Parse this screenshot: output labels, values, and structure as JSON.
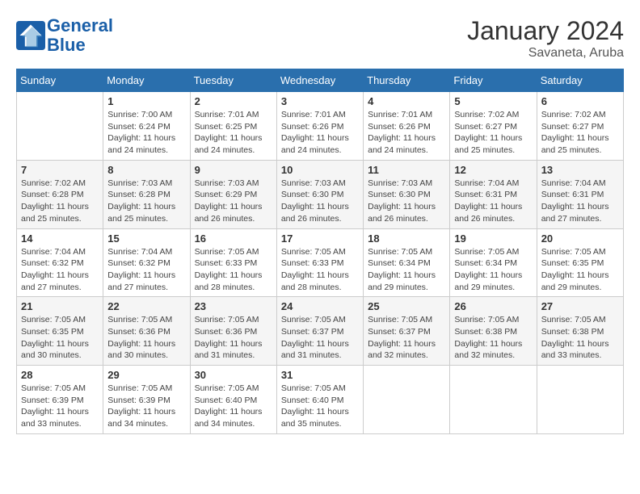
{
  "header": {
    "logo_line1": "General",
    "logo_line2": "Blue",
    "title": "January 2024",
    "subtitle": "Savaneta, Aruba"
  },
  "days_of_week": [
    "Sunday",
    "Monday",
    "Tuesday",
    "Wednesday",
    "Thursday",
    "Friday",
    "Saturday"
  ],
  "weeks": [
    [
      {
        "day": "",
        "info": ""
      },
      {
        "day": "1",
        "info": "Sunrise: 7:00 AM\nSunset: 6:24 PM\nDaylight: 11 hours\nand 24 minutes."
      },
      {
        "day": "2",
        "info": "Sunrise: 7:01 AM\nSunset: 6:25 PM\nDaylight: 11 hours\nand 24 minutes."
      },
      {
        "day": "3",
        "info": "Sunrise: 7:01 AM\nSunset: 6:26 PM\nDaylight: 11 hours\nand 24 minutes."
      },
      {
        "day": "4",
        "info": "Sunrise: 7:01 AM\nSunset: 6:26 PM\nDaylight: 11 hours\nand 24 minutes."
      },
      {
        "day": "5",
        "info": "Sunrise: 7:02 AM\nSunset: 6:27 PM\nDaylight: 11 hours\nand 25 minutes."
      },
      {
        "day": "6",
        "info": "Sunrise: 7:02 AM\nSunset: 6:27 PM\nDaylight: 11 hours\nand 25 minutes."
      }
    ],
    [
      {
        "day": "7",
        "info": "Sunrise: 7:02 AM\nSunset: 6:28 PM\nDaylight: 11 hours\nand 25 minutes."
      },
      {
        "day": "8",
        "info": "Sunrise: 7:03 AM\nSunset: 6:28 PM\nDaylight: 11 hours\nand 25 minutes."
      },
      {
        "day": "9",
        "info": "Sunrise: 7:03 AM\nSunset: 6:29 PM\nDaylight: 11 hours\nand 26 minutes."
      },
      {
        "day": "10",
        "info": "Sunrise: 7:03 AM\nSunset: 6:30 PM\nDaylight: 11 hours\nand 26 minutes."
      },
      {
        "day": "11",
        "info": "Sunrise: 7:03 AM\nSunset: 6:30 PM\nDaylight: 11 hours\nand 26 minutes."
      },
      {
        "day": "12",
        "info": "Sunrise: 7:04 AM\nSunset: 6:31 PM\nDaylight: 11 hours\nand 26 minutes."
      },
      {
        "day": "13",
        "info": "Sunrise: 7:04 AM\nSunset: 6:31 PM\nDaylight: 11 hours\nand 27 minutes."
      }
    ],
    [
      {
        "day": "14",
        "info": "Sunrise: 7:04 AM\nSunset: 6:32 PM\nDaylight: 11 hours\nand 27 minutes."
      },
      {
        "day": "15",
        "info": "Sunrise: 7:04 AM\nSunset: 6:32 PM\nDaylight: 11 hours\nand 27 minutes."
      },
      {
        "day": "16",
        "info": "Sunrise: 7:05 AM\nSunset: 6:33 PM\nDaylight: 11 hours\nand 28 minutes."
      },
      {
        "day": "17",
        "info": "Sunrise: 7:05 AM\nSunset: 6:33 PM\nDaylight: 11 hours\nand 28 minutes."
      },
      {
        "day": "18",
        "info": "Sunrise: 7:05 AM\nSunset: 6:34 PM\nDaylight: 11 hours\nand 29 minutes."
      },
      {
        "day": "19",
        "info": "Sunrise: 7:05 AM\nSunset: 6:34 PM\nDaylight: 11 hours\nand 29 minutes."
      },
      {
        "day": "20",
        "info": "Sunrise: 7:05 AM\nSunset: 6:35 PM\nDaylight: 11 hours\nand 29 minutes."
      }
    ],
    [
      {
        "day": "21",
        "info": "Sunrise: 7:05 AM\nSunset: 6:35 PM\nDaylight: 11 hours\nand 30 minutes."
      },
      {
        "day": "22",
        "info": "Sunrise: 7:05 AM\nSunset: 6:36 PM\nDaylight: 11 hours\nand 30 minutes."
      },
      {
        "day": "23",
        "info": "Sunrise: 7:05 AM\nSunset: 6:36 PM\nDaylight: 11 hours\nand 31 minutes."
      },
      {
        "day": "24",
        "info": "Sunrise: 7:05 AM\nSunset: 6:37 PM\nDaylight: 11 hours\nand 31 minutes."
      },
      {
        "day": "25",
        "info": "Sunrise: 7:05 AM\nSunset: 6:37 PM\nDaylight: 11 hours\nand 32 minutes."
      },
      {
        "day": "26",
        "info": "Sunrise: 7:05 AM\nSunset: 6:38 PM\nDaylight: 11 hours\nand 32 minutes."
      },
      {
        "day": "27",
        "info": "Sunrise: 7:05 AM\nSunset: 6:38 PM\nDaylight: 11 hours\nand 33 minutes."
      }
    ],
    [
      {
        "day": "28",
        "info": "Sunrise: 7:05 AM\nSunset: 6:39 PM\nDaylight: 11 hours\nand 33 minutes."
      },
      {
        "day": "29",
        "info": "Sunrise: 7:05 AM\nSunset: 6:39 PM\nDaylight: 11 hours\nand 34 minutes."
      },
      {
        "day": "30",
        "info": "Sunrise: 7:05 AM\nSunset: 6:40 PM\nDaylight: 11 hours\nand 34 minutes."
      },
      {
        "day": "31",
        "info": "Sunrise: 7:05 AM\nSunset: 6:40 PM\nDaylight: 11 hours\nand 35 minutes."
      },
      {
        "day": "",
        "info": ""
      },
      {
        "day": "",
        "info": ""
      },
      {
        "day": "",
        "info": ""
      }
    ]
  ]
}
